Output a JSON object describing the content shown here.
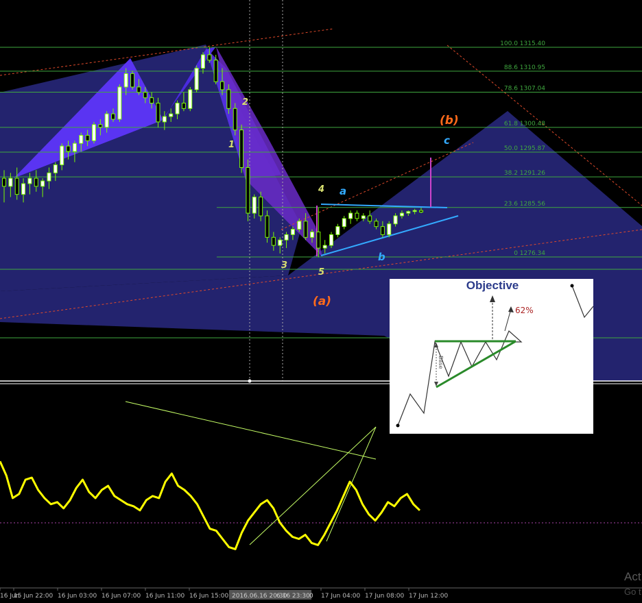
{
  "chart_data": {
    "type": "candlestick",
    "price_ylim": [
      1270.5,
      1317.2
    ],
    "fib_levels": [
      {
        "label": "100.0 1315.40",
        "price": 1315.4
      },
      {
        "label": "88.6 1310.95",
        "price": 1310.95
      },
      {
        "label": "78.6 1307.04",
        "price": 1307.04
      },
      {
        "label": "61.8 1300.48",
        "price": 1300.48
      },
      {
        "label": "50.0 1295.87",
        "price": 1295.87
      },
      {
        "label": "38.2 1291.26",
        "price": 1291.26
      },
      {
        "label": "23.6 1285.56",
        "price": 1285.56
      },
      {
        "label": "0 1276.34",
        "price": 1276.34
      }
    ],
    "candles": [
      [
        1291.0,
        1292.5,
        1286.5,
        1289.5
      ],
      [
        1289.5,
        1292.0,
        1287.5,
        1291.0
      ],
      [
        1291.0,
        1293.0,
        1287.0,
        1288.0
      ],
      [
        1288.0,
        1291.0,
        1286.5,
        1290.0
      ],
      [
        1290.0,
        1292.0,
        1288.0,
        1291.0
      ],
      [
        1291.0,
        1292.5,
        1288.5,
        1289.5
      ],
      [
        1289.5,
        1291.0,
        1287.5,
        1290.5
      ],
      [
        1290.5,
        1293.0,
        1289.0,
        1292.0
      ],
      [
        1292.0,
        1294.0,
        1290.5,
        1293.5
      ],
      [
        1293.5,
        1297.5,
        1292.5,
        1297.0
      ],
      [
        1297.0,
        1298.0,
        1294.5,
        1296.0
      ],
      [
        1296.0,
        1298.0,
        1294.0,
        1297.5
      ],
      [
        1297.5,
        1299.5,
        1296.0,
        1299.0
      ],
      [
        1299.0,
        1300.0,
        1297.0,
        1298.0
      ],
      [
        1298.0,
        1301.5,
        1297.5,
        1301.0
      ],
      [
        1301.0,
        1302.0,
        1299.0,
        1300.5
      ],
      [
        1300.5,
        1303.5,
        1299.5,
        1303.0
      ],
      [
        1303.0,
        1304.0,
        1301.5,
        1302.0
      ],
      [
        1302.0,
        1308.5,
        1301.5,
        1308.0
      ],
      [
        1308.0,
        1311.5,
        1306.5,
        1310.5
      ],
      [
        1310.5,
        1311.0,
        1307.5,
        1308.0
      ],
      [
        1308.0,
        1309.5,
        1306.5,
        1307.0
      ],
      [
        1307.0,
        1308.0,
        1305.0,
        1306.0
      ],
      [
        1306.0,
        1307.0,
        1304.0,
        1305.0
      ],
      [
        1305.0,
        1306.0,
        1300.5,
        1301.5
      ],
      [
        1301.5,
        1303.5,
        1300.0,
        1302.5
      ],
      [
        1302.5,
        1304.0,
        1301.5,
        1303.0
      ],
      [
        1303.0,
        1305.5,
        1302.0,
        1305.0
      ],
      [
        1305.0,
        1307.0,
        1303.5,
        1304.0
      ],
      [
        1304.0,
        1308.0,
        1303.5,
        1307.5
      ],
      [
        1307.5,
        1312.0,
        1307.0,
        1311.5
      ],
      [
        1311.5,
        1314.5,
        1310.5,
        1314.0
      ],
      [
        1314.0,
        1315.4,
        1312.5,
        1313.0
      ],
      [
        1313.0,
        1314.0,
        1308.5,
        1309.0
      ],
      [
        1309.0,
        1311.5,
        1306.5,
        1307.5
      ],
      [
        1307.5,
        1308.5,
        1303.0,
        1304.0
      ],
      [
        1304.0,
        1305.0,
        1299.0,
        1300.0
      ],
      [
        1300.0,
        1301.0,
        1292.0,
        1293.0
      ],
      [
        1293.0,
        1294.5,
        1283.0,
        1284.5
      ],
      [
        1284.5,
        1288.0,
        1283.5,
        1287.5
      ],
      [
        1287.5,
        1288.5,
        1283.0,
        1284.0
      ],
      [
        1284.0,
        1285.0,
        1279.0,
        1280.0
      ],
      [
        1280.0,
        1281.0,
        1277.5,
        1278.5
      ],
      [
        1278.5,
        1280.0,
        1277.0,
        1279.5
      ],
      [
        1279.5,
        1281.0,
        1278.0,
        1280.5
      ],
      [
        1280.5,
        1282.0,
        1279.5,
        1281.5
      ],
      [
        1281.5,
        1283.5,
        1281.0,
        1283.0
      ],
      [
        1283.0,
        1284.5,
        1279.5,
        1280.0
      ],
      [
        1280.0,
        1281.5,
        1279.0,
        1281.0
      ],
      [
        1281.0,
        1285.5,
        1276.3,
        1278.0
      ],
      [
        1278.0,
        1279.5,
        1277.0,
        1278.5
      ],
      [
        1278.5,
        1281.0,
        1278.0,
        1280.5
      ],
      [
        1280.5,
        1282.5,
        1280.0,
        1282.0
      ],
      [
        1282.0,
        1284.0,
        1281.5,
        1283.5
      ],
      [
        1283.5,
        1285.0,
        1282.5,
        1284.5
      ],
      [
        1284.5,
        1285.0,
        1283.0,
        1283.5
      ],
      [
        1283.5,
        1284.5,
        1283.0,
        1284.0
      ],
      [
        1284.0,
        1285.0,
        1282.5,
        1283.0
      ],
      [
        1283.0,
        1283.5,
        1281.5,
        1282.0
      ],
      [
        1282.0,
        1283.0,
        1280.0,
        1280.5
      ],
      [
        1280.5,
        1283.0,
        1280.0,
        1282.5
      ],
      [
        1282.5,
        1284.5,
        1282.0,
        1284.0
      ],
      [
        1284.0,
        1285.0,
        1283.5,
        1284.5
      ],
      [
        1284.5,
        1285.0,
        1284.0,
        1284.8
      ],
      [
        1284.8,
        1285.3,
        1284.3,
        1285.0
      ],
      [
        1285.0,
        1285.5,
        1284.5,
        1284.7
      ]
    ],
    "oscillator": [
      62,
      55,
      44,
      46,
      53,
      54,
      48,
      44,
      41,
      42,
      39,
      43,
      49,
      53,
      47,
      44,
      48,
      50,
      45,
      43,
      41,
      40,
      38,
      43,
      45,
      44,
      52,
      56,
      50,
      48,
      45,
      41,
      35,
      29,
      28,
      24,
      20,
      19,
      27,
      33,
      37,
      41,
      43,
      39,
      32,
      28,
      25,
      24,
      26,
      22,
      21,
      26,
      32,
      38,
      45,
      52,
      48,
      41,
      36,
      33,
      37,
      42,
      40,
      44,
      46,
      41,
      38
    ],
    "osc_ylim": [
      0,
      100
    ],
    "x_labels": [
      "16 Jun",
      "15 Jun 22:00",
      "16 Jun 03:00",
      "16 Jun 07:00",
      "16 Jun 11:00",
      "16 Jun 15:00",
      "17 Jun 04:00",
      "17 Jun 08:00",
      "17 Jun 12:00"
    ],
    "x_highlight": [
      "2016.06.16 20:30",
      "6.16 23:30",
      "0"
    ]
  },
  "annotations": {
    "w1": "1",
    "w2": "2",
    "w3": "3",
    "w4": "4",
    "w5": "5",
    "a": "a",
    "b": "b",
    "c": "c",
    "pa": "(a)",
    "pb": "(b)"
  },
  "inset": {
    "title": "Objective",
    "pct": "62%",
    "base": "Base"
  },
  "watermark": {
    "line1": "Act",
    "line2": "Go t"
  },
  "colors": {
    "bg": "#000000",
    "bull": "#ffffff",
    "bear": "#7cfc00",
    "fib": "#3fa83f",
    "harmonic": "#6a2cff",
    "channel": "#2a2a7a",
    "oscillator": "#ffff00",
    "trend": "#c6ff66",
    "wave_label": "#d8e070",
    "cyan": "#33aaff",
    "orange": "#ff6a1a",
    "magenta": "#cc44cc"
  }
}
